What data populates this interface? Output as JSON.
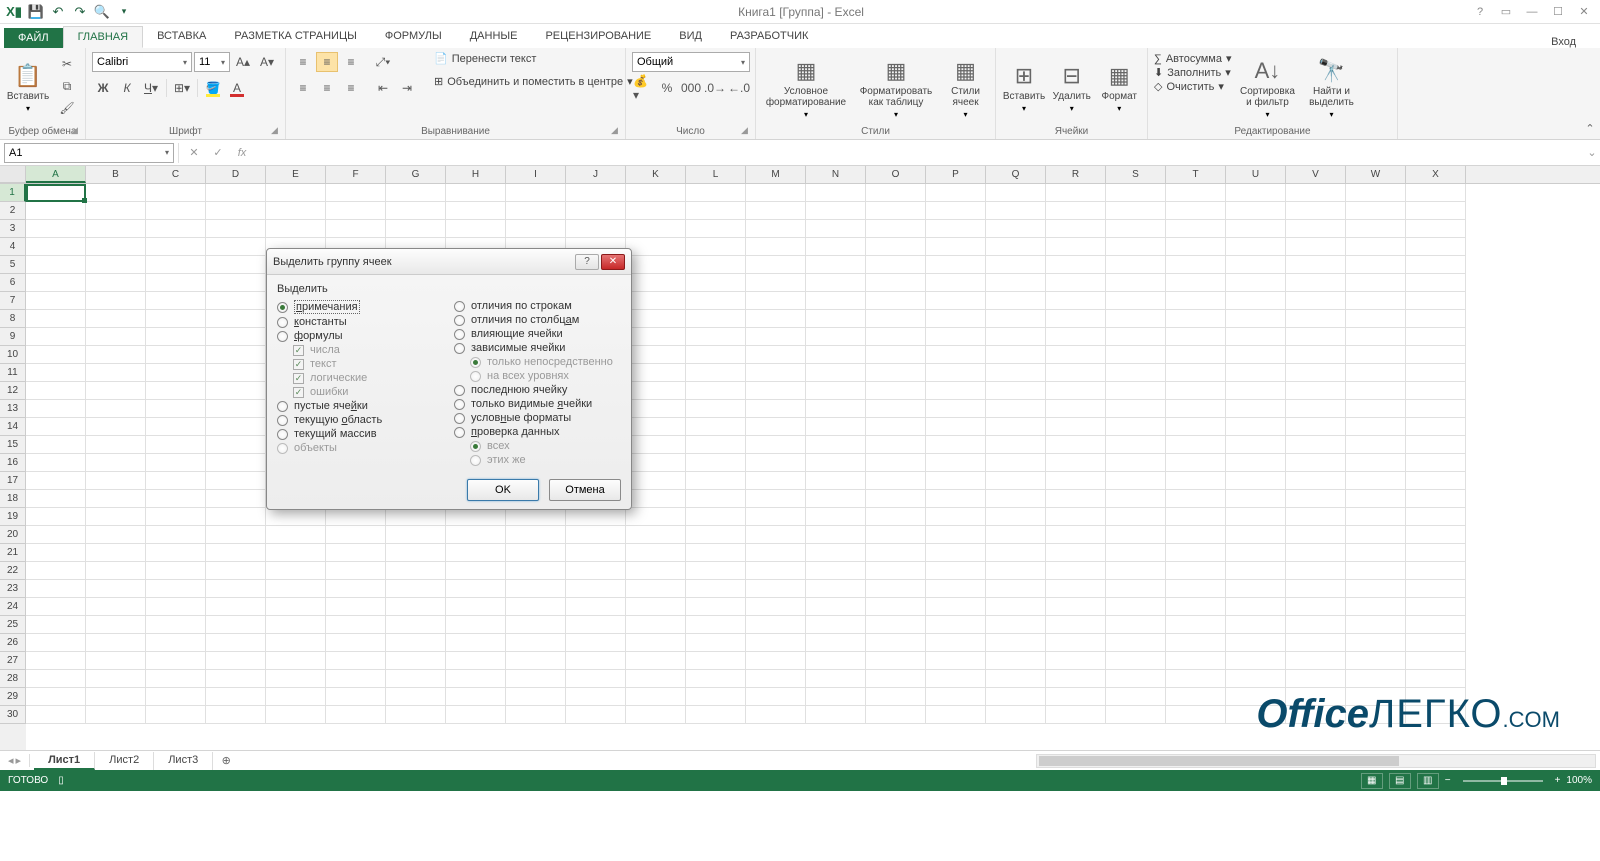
{
  "title": "Книга1 [Группа] - Excel",
  "login": "Вход",
  "tabs": {
    "file": "ФАЙЛ",
    "list": [
      "ГЛАВНАЯ",
      "ВСТАВКА",
      "РАЗМЕТКА СТРАНИЦЫ",
      "ФОРМУЛЫ",
      "ДАННЫЕ",
      "РЕЦЕНЗИРОВАНИЕ",
      "ВИД",
      "РАЗРАБОТЧИК"
    ],
    "active": 0
  },
  "ribbon": {
    "clipboard": {
      "label": "Буфер обмена",
      "paste": "Вставить"
    },
    "font": {
      "label": "Шрифт",
      "name": "Calibri",
      "size": "11"
    },
    "align": {
      "label": "Выравнивание",
      "wrap": "Перенести текст",
      "merge": "Объединить и поместить в центре"
    },
    "number": {
      "label": "Число",
      "format": "Общий"
    },
    "styles": {
      "label": "Стили",
      "cond": "Условное форматирование",
      "table": "Форматировать как таблицу",
      "cell": "Стили ячеек"
    },
    "cells": {
      "label": "Ячейки",
      "insert": "Вставить",
      "delete": "Удалить",
      "format": "Формат"
    },
    "editing": {
      "label": "Редактирование",
      "autosum": "Автосумма",
      "fill": "Заполнить",
      "clear": "Очистить",
      "sort": "Сортировка и фильтр",
      "find": "Найти и выделить"
    }
  },
  "nameBox": "A1",
  "columns": [
    "A",
    "B",
    "C",
    "D",
    "E",
    "F",
    "G",
    "H",
    "I",
    "J",
    "K",
    "L",
    "M",
    "N",
    "O",
    "P",
    "Q",
    "R",
    "S",
    "T",
    "U",
    "V",
    "W",
    "X"
  ],
  "rowCount": 30,
  "sheets": [
    "Лист1",
    "Лист2",
    "Лист3"
  ],
  "activeSheet": 0,
  "status": {
    "ready": "ГОТОВО",
    "zoom": "100%"
  },
  "dialog": {
    "title": "Выделить группу ячеек",
    "section": "Выделить",
    "left": [
      {
        "t": "radio",
        "label": "примечания",
        "checked": true,
        "focus": true,
        "u": 0
      },
      {
        "t": "radio",
        "label": "константы",
        "u": 0
      },
      {
        "t": "radio",
        "label": "формулы",
        "u": 0
      },
      {
        "t": "check",
        "label": "числа",
        "sub": true,
        "checked": true,
        "disabled": true,
        "u": -1
      },
      {
        "t": "check",
        "label": "текст",
        "sub": true,
        "checked": true,
        "disabled": true,
        "u": -1
      },
      {
        "t": "check",
        "label": "логические",
        "sub": true,
        "checked": true,
        "disabled": true,
        "u": -1
      },
      {
        "t": "check",
        "label": "ошибки",
        "sub": true,
        "checked": true,
        "disabled": true,
        "u": -1
      },
      {
        "t": "radio",
        "label": "пустые ячейки",
        "u": 10
      },
      {
        "t": "radio",
        "label": "текущую область",
        "u": 8
      },
      {
        "t": "radio",
        "label": "текущий массив",
        "u": -1
      },
      {
        "t": "radio",
        "label": "объекты",
        "disabled": true,
        "u": -1
      }
    ],
    "right": [
      {
        "t": "radio",
        "label": "отличия по строкам",
        "u": -1
      },
      {
        "t": "radio",
        "label": "отличия по столбцам",
        "u": 17
      },
      {
        "t": "radio",
        "label": "влияющие ячейки",
        "u": -1
      },
      {
        "t": "radio",
        "label": "зависимые ячейки",
        "u": -1
      },
      {
        "t": "radio",
        "label": "только непосредственно",
        "sub": true,
        "checked": true,
        "disabled": true,
        "u": -1
      },
      {
        "t": "radio",
        "label": "на всех уровнях",
        "sub": true,
        "disabled": true,
        "u": -1
      },
      {
        "t": "radio",
        "label": "последнюю ячейку",
        "u": 5
      },
      {
        "t": "radio",
        "label": "только видимые ячейки",
        "u": 15
      },
      {
        "t": "radio",
        "label": "условные форматы",
        "u": 5
      },
      {
        "t": "radio",
        "label": "проверка данных",
        "u": 0
      },
      {
        "t": "radio",
        "label": "всех",
        "sub": true,
        "checked": true,
        "disabled": true,
        "u": -1
      },
      {
        "t": "radio",
        "label": "этих же",
        "sub": true,
        "disabled": true,
        "u": -1
      }
    ],
    "ok": "OK",
    "cancel": "Отмена"
  },
  "watermark": {
    "office": "Office",
    "legko": "ЛЕГКО",
    "com": ".COM"
  }
}
